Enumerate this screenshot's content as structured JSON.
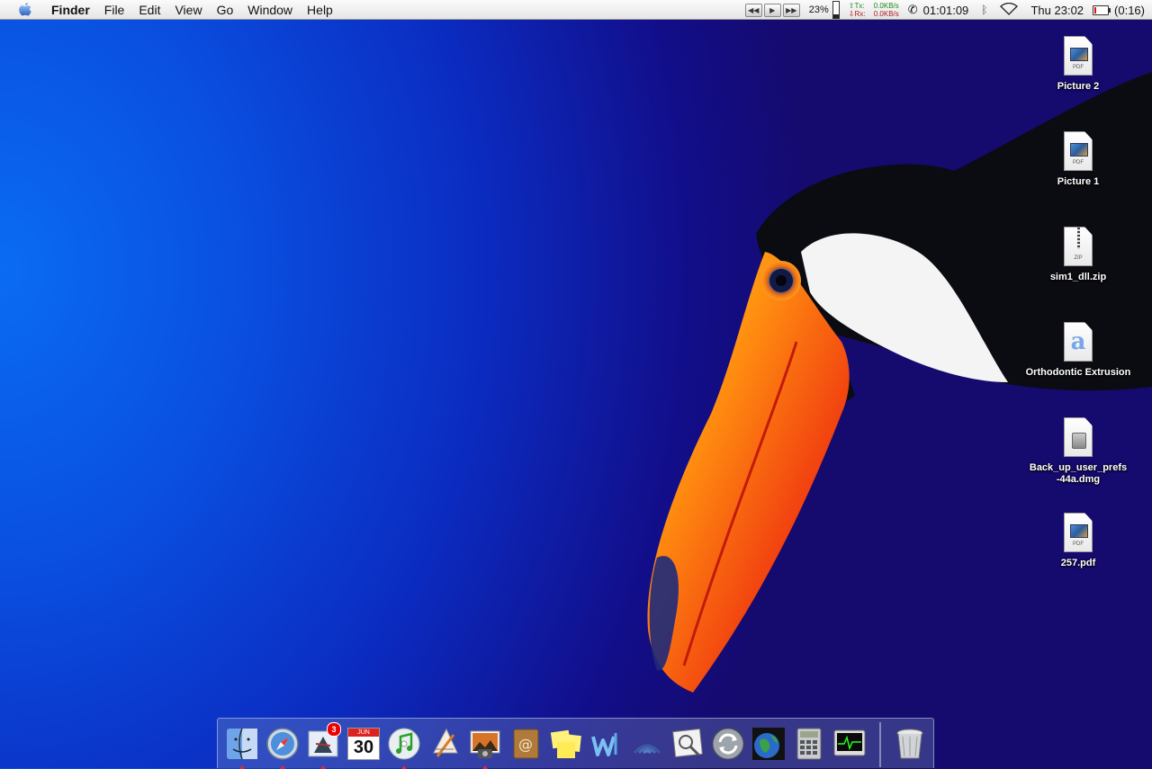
{
  "menubar": {
    "app_name": "Finder",
    "menus": [
      "File",
      "Edit",
      "View",
      "Go",
      "Window",
      "Help"
    ],
    "cpu_percent": "23%",
    "cpu_level": 0.23,
    "net": {
      "tx_label": "Tx:",
      "tx_value": "0.0KB/s",
      "rx_label": "Rx:",
      "rx_value": "0.0KB/s"
    },
    "timer": "01:01:09",
    "datetime": "Thu 23:02",
    "battery_time": "(0:16)",
    "battery_level": 0.1
  },
  "desktop_icons": [
    {
      "label": "Picture 2",
      "type": "pdf",
      "tag": "PDF"
    },
    {
      "label": "Picture 1",
      "type": "pdf",
      "tag": "PDF"
    },
    {
      "label": "sim1_dll.zip",
      "type": "zip",
      "tag": "ZIP"
    },
    {
      "label": "Orthodontic Extrusion",
      "type": "word",
      "tag": ""
    },
    {
      "label": "Back_up_user_prefs -44a.dmg",
      "type": "dmg",
      "tag": ""
    },
    {
      "label": "257.pdf",
      "type": "pdf",
      "tag": "PDF"
    }
  ],
  "dock": {
    "calendar_month": "JUN",
    "calendar_day": "30",
    "mail_badge": "3",
    "items": [
      "finder-icon",
      "safari-icon",
      "mail-icon",
      "ical-icon",
      "itunes-icon",
      "textedit-icon",
      "iphoto-icon",
      "address-book-icon",
      "stickies-icon",
      "word-icon",
      "airport-icon",
      "preview-icon",
      "sync-icon",
      "world-clock-icon",
      "calculator-icon",
      "activity-monitor-icon",
      "trash-icon"
    ]
  },
  "colors": {
    "desktop_light": "#0a6cf2",
    "desktop_dark": "#150a6e",
    "menubar": "#f0f0f0"
  }
}
